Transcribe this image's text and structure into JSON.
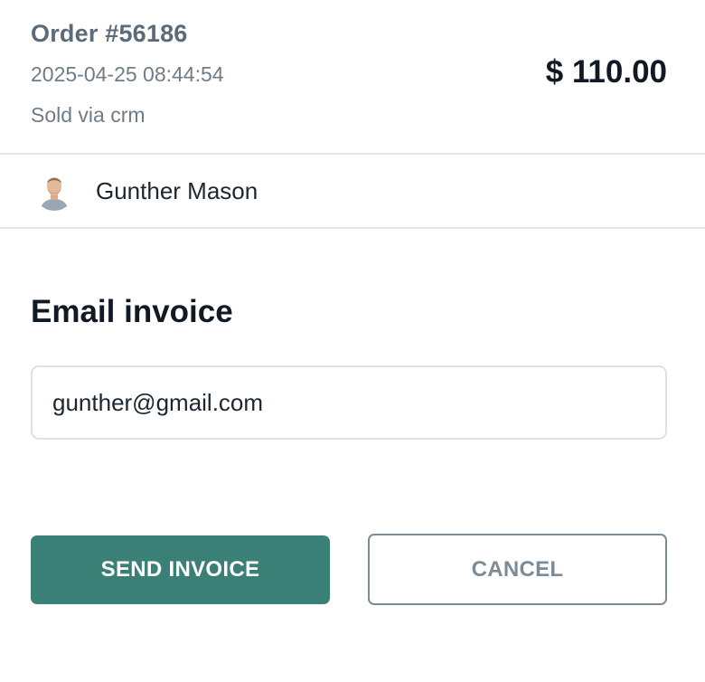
{
  "order": {
    "number": "Order #56186",
    "datetime": "2025-04-25 08:44:54",
    "channel": "Sold via crm",
    "total": "$ 110.00"
  },
  "customer": {
    "name": "Gunther Mason",
    "avatar_icon": "user-avatar-photo"
  },
  "invoice": {
    "title": "Email invoice",
    "email_value": "gunther@gmail.com"
  },
  "actions": {
    "send_label": "SEND INVOICE",
    "cancel_label": "CANCEL"
  },
  "colors": {
    "accent": "#3b8077",
    "muted_text": "#6f7c88",
    "divider": "#e2e4e7"
  }
}
